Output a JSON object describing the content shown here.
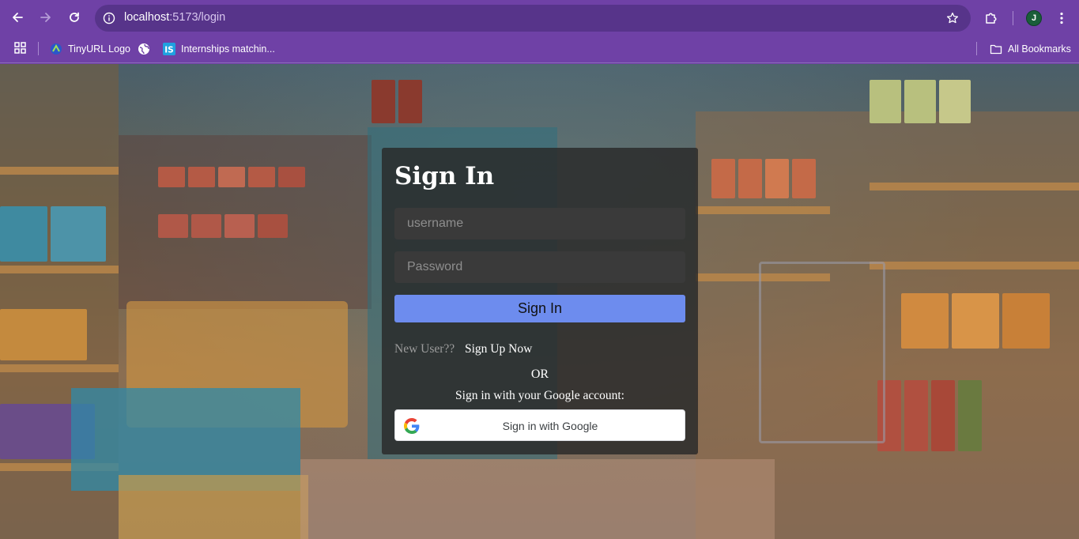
{
  "browser": {
    "url_host": "localhost",
    "url_path": ":5173/login",
    "profile_initial": "J",
    "icons": [
      "back-arrow-icon",
      "forward-arrow-icon",
      "reload-icon",
      "site-info-icon",
      "bookmark-star-icon",
      "extensions-icon",
      "kebab-menu-icon"
    ]
  },
  "bookmarks": {
    "items": [
      {
        "label": "TinyURL Logo",
        "icon": "tinyurl-favicon"
      },
      {
        "label": "",
        "icon": "globe-icon"
      },
      {
        "label": "Internships matchin...",
        "icon": "internshala-favicon"
      }
    ],
    "all_bookmarks_label": "All Bookmarks"
  },
  "login": {
    "title": "Sign In",
    "username_placeholder": "username",
    "password_placeholder": "Password",
    "signin_button": "Sign In",
    "new_user_text": "New User??",
    "signup_link": "Sign Up Now",
    "or_text": "OR",
    "google_prompt": "Sign in with your Google account:",
    "google_button": "Sign in with Google"
  },
  "colors": {
    "browser_purple": "#6f41a6",
    "omnibox": "#57348a",
    "card_bg": "#282828",
    "signin_button": "#6d8cee",
    "profile_bg": "#1a5e3a"
  }
}
